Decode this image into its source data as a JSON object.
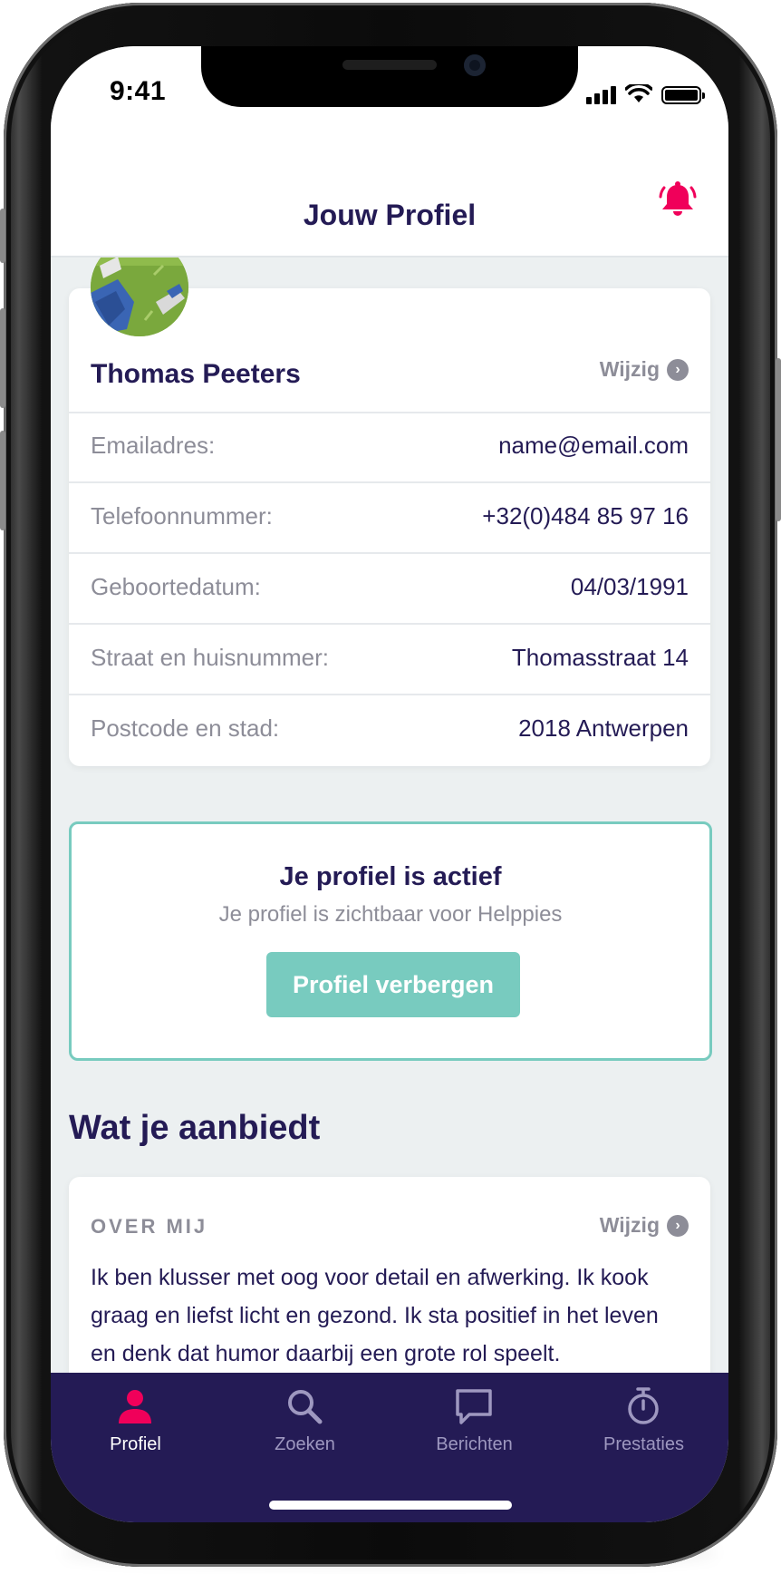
{
  "status_bar": {
    "time": "9:41"
  },
  "nav": {
    "title": "Jouw Profiel"
  },
  "profile": {
    "name": "Thomas Peeters",
    "edit_label": "Wijzig",
    "fields": [
      {
        "label": "Emailadres:",
        "value": "name@email.com"
      },
      {
        "label": "Telefoonnummer:",
        "value": "+32(0)484 85 97 16"
      },
      {
        "label": "Geboortedatum:",
        "value": "04/03/1991"
      },
      {
        "label": "Straat en huisnummer:",
        "value": "Thomasstraat 14"
      },
      {
        "label": "Postcode en stad:",
        "value": "2018 Antwerpen"
      }
    ]
  },
  "status": {
    "title": "Je profiel is actief",
    "subtitle": "Je profiel is zichtbaar voor Helppies",
    "button_label": "Profiel verbergen"
  },
  "offer": {
    "section_title": "Wat je aanbiedt",
    "about_label": "OVER MIJ",
    "edit_label": "Wijzig",
    "about_text": "Ik ben klusser met oog voor detail en afwerking. Ik kook graag en liefst licht en gezond. Ik sta positief in het leven en denk dat humor daarbij een grote rol speelt."
  },
  "tabs": [
    {
      "label": "Profiel",
      "icon": "person-icon",
      "active": true
    },
    {
      "label": "Zoeken",
      "icon": "search-icon",
      "active": false
    },
    {
      "label": "Berichten",
      "icon": "chat-icon",
      "active": false
    },
    {
      "label": "Prestaties",
      "icon": "stopwatch-icon",
      "active": false
    }
  ],
  "colors": {
    "primary": "#241b55",
    "accent": "#78cbbf",
    "alert": "#f0005a",
    "muted": "#8d8d98",
    "background": "#ecf0f1"
  }
}
